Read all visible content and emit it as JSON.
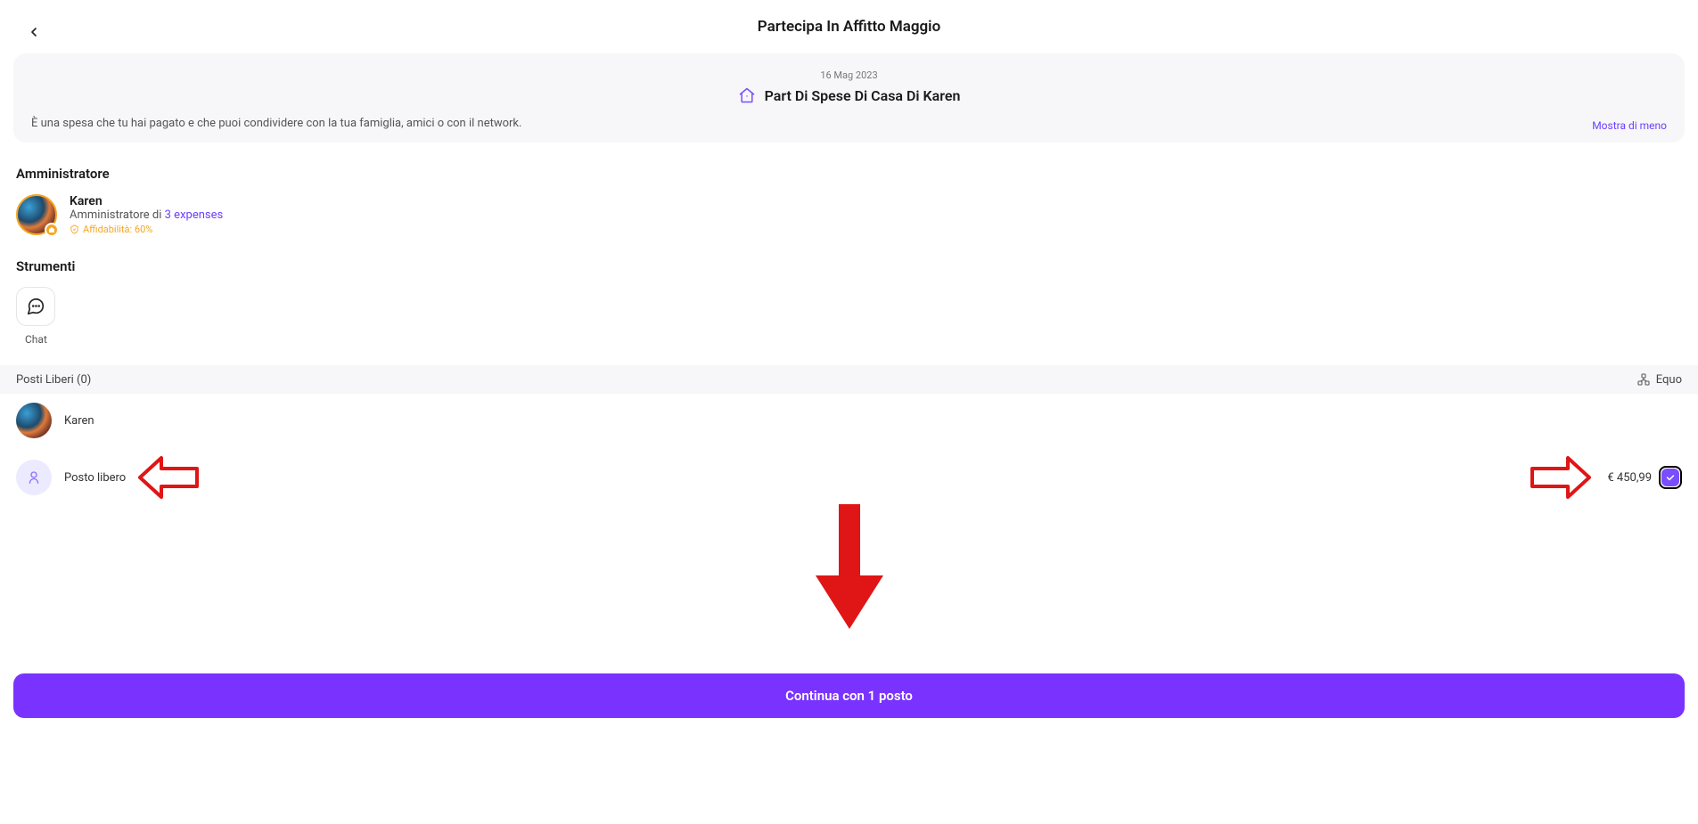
{
  "header": {
    "title": "Partecipa In Affitto Maggio"
  },
  "info": {
    "date": "16 Mag 2023",
    "title": "Part Di Spese Di Casa Di Karen",
    "description": "È una spesa che tu hai pagato e che puoi condividere con la tua famiglia, amici o con il network.",
    "show_less": "Mostra di meno"
  },
  "admin": {
    "section_label": "Amministratore",
    "name": "Karen",
    "role_prefix": "Amministratore di ",
    "expenses_link": "3 expenses",
    "reliability_label": "Affidabilità: 60%"
  },
  "tools": {
    "section_label": "Strumenti",
    "chat_label": "Chat"
  },
  "slots": {
    "header_label": "Posti Liberi (0)",
    "equo_label": "Equo",
    "rows": [
      {
        "name": "Karen"
      },
      {
        "name": "Posto libero",
        "price": "€ 450,99"
      }
    ]
  },
  "cta": {
    "label": "Continua con 1 posto"
  }
}
